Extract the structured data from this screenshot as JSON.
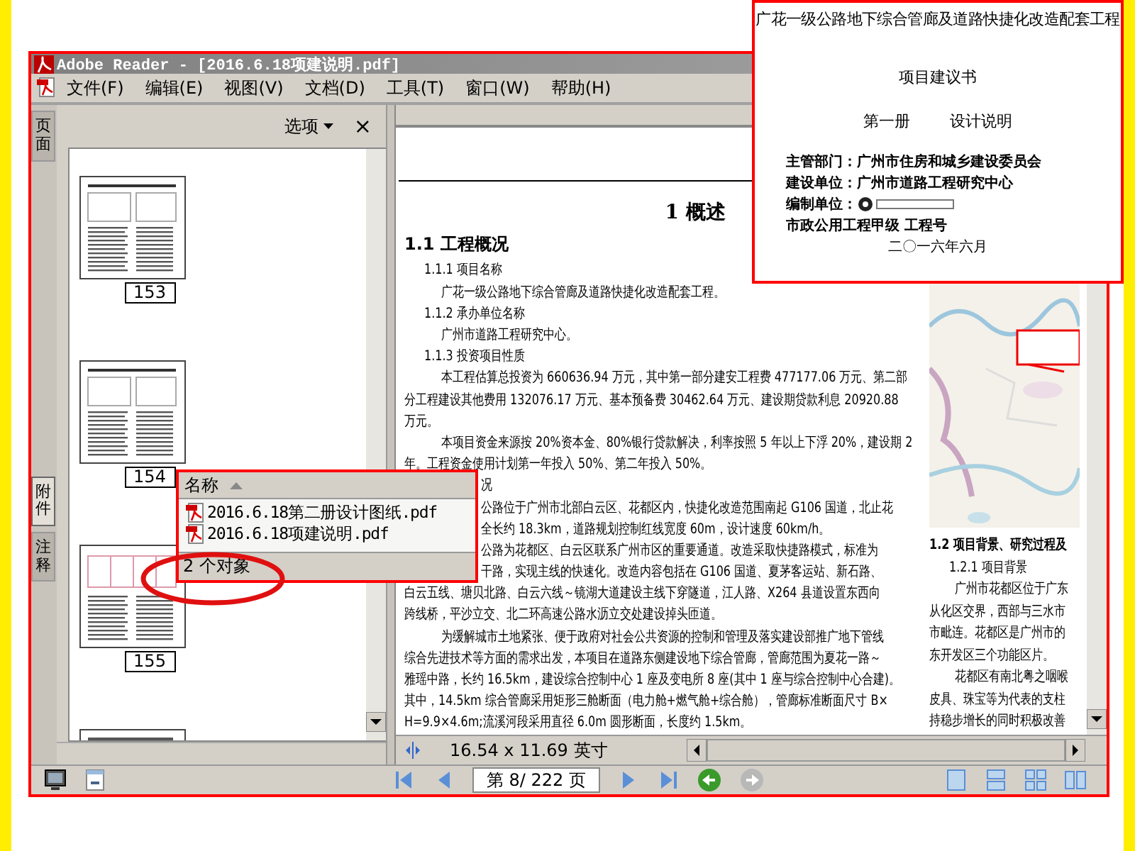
{
  "window": {
    "title": "Adobe Reader - [2016.6.18项建说明.pdf]"
  },
  "menu": [
    "文件(F)",
    "编辑(E)",
    "视图(V)",
    "文档(D)",
    "工具(T)",
    "窗口(W)",
    "帮助(H)"
  ],
  "side_tabs": [
    {
      "label": "页面",
      "selected": false
    },
    {
      "label": "附件",
      "selected": true
    },
    {
      "label": "注释",
      "selected": false
    }
  ],
  "nav_panel": {
    "options": "选项",
    "close": "×",
    "thumbnails": [
      "153",
      "154",
      "155"
    ]
  },
  "document": {
    "left_page": [
      {
        "kind": "title",
        "text": "1 概述"
      },
      {
        "kind": "h2",
        "text": "1.1 工程概况"
      },
      {
        "kind": "h3",
        "text": "1.1.1 项目名称"
      },
      {
        "kind": "indent",
        "text": "广花一级公路地下综合管廊及道路快捷化改造配套工程。"
      },
      {
        "kind": "h3",
        "text": "1.1.2 承办单位名称"
      },
      {
        "kind": "indent",
        "text": "广州市道路工程研究中心。"
      },
      {
        "kind": "h3",
        "text": "1.1.3 投资项目性质"
      },
      {
        "kind": "indent",
        "text": "本工程估算总投资为 660636.94 万元，其中第一部分建安工程费 477177.06 万元、第二部"
      },
      {
        "kind": "line",
        "text": "分工程建设其他费用 132076.17 万元、基本预备费 30462.64 万元、建设期贷款利息 20920.88"
      },
      {
        "kind": "line",
        "text": "万元。"
      },
      {
        "kind": "indent",
        "text": "本项目资金来源按 20%资本金、80%银行贷款解决，利率按照 5 年以上下浮 20%，建设期 2"
      },
      {
        "kind": "line",
        "text": "年。工程资金使用计划第一年投入 50%、第二年投入 50%。"
      },
      {
        "kind": "tail",
        "text": "况"
      },
      {
        "kind": "tail",
        "text": "公路位于广州市北部白云区、花都区内，快捷化改造范围南起 G106 国道，北止花"
      },
      {
        "kind": "tail",
        "text": "全长约 18.3km，道路规划控制红线宽度 60m，设计速度 60km/h。"
      },
      {
        "kind": "tail",
        "text": "公路为花都区、白云区联系广州市区的重要通道。改造采取快捷路模式，标准为"
      },
      {
        "kind": "tail",
        "text": "干路，实现主线的快速化。改造内容包括在 G106 国道、夏茅客运站、新石路、"
      },
      {
        "kind": "line",
        "text": "白云五线、塘贝北路、白云六线～镜湖大道建设主线下穿隧道，江人路、X264 县道设置东西向"
      },
      {
        "kind": "line",
        "text": "跨线桥，平沙立交、北二环高速公路水沥立交处建设掉头匝道。"
      },
      {
        "kind": "indent",
        "text": "为缓解城市土地紧张、便于政府对社会公共资源的控制和管理及落实建设部推广地下管线"
      },
      {
        "kind": "line",
        "text": "综合先进技术等方面的需求出发，本项目在道路东侧建设地下综合管廊，管廊范围为夏花一路～"
      },
      {
        "kind": "line",
        "text": "雅瑶中路，长约 16.5km，建设综合控制中心 1 座及变电所 8 座(其中 1 座与综合控制中心合建)。"
      },
      {
        "kind": "line",
        "text": "其中，14.5km 综合管廊采用矩形三舱断面（电力舱+燃气舱+综合舱），管廊标准断面尺寸 B×"
      },
      {
        "kind": "line",
        "text": "H=9.9×4.6m;流溪河段采用直径 6.0m 圆形断面，长度约 1.5km。"
      }
    ],
    "right_page": [
      {
        "kind": "h2",
        "text": "1.2 项目背景、研究过程及"
      },
      {
        "kind": "h3",
        "text": "1.2.1 项目背景"
      },
      {
        "kind": "indent",
        "text": "广州市花都区位于广东"
      },
      {
        "kind": "line",
        "text": "从化区交界，西部与三水市"
      },
      {
        "kind": "line",
        "text": "市毗连。花都区是广州市的"
      },
      {
        "kind": "line",
        "text": "东开发区三个功能区片。"
      },
      {
        "kind": "indent",
        "text": "花都区有南北粤之咽喉"
      },
      {
        "kind": "line",
        "text": "皮具、珠宝等为代表的支柱"
      },
      {
        "kind": "line",
        "text": "持稳步增长的同时积极改善"
      }
    ]
  },
  "doc_toolbar": {
    "page_size": "16.54 x 11.69 英寸"
  },
  "status_bar": {
    "page_field": "第 8/ 222 页",
    "previous_view": {
      "disabled": false
    },
    "next_view": {
      "disabled": true
    }
  },
  "attachments_popup": {
    "column": "名称",
    "files": [
      "2016.6.18第二册设计图纸.pdf",
      "2016.6.18项建说明.pdf"
    ],
    "count": "2 个对象"
  },
  "cover_page": {
    "title": "广花一级公路地下综合管廊及道路快捷化改造配套工程",
    "subtitle": "项目建议书",
    "volume": "第一册",
    "part": "设计说明",
    "details": [
      {
        "kind": "text",
        "text": "主管部门：广州市住房和城乡建设委员会"
      },
      {
        "kind": "text",
        "text": "建设单位：广州市道路工程研究中心"
      },
      {
        "kind": "logo",
        "text": "编制单位："
      },
      {
        "kind": "text",
        "text": "市政公用工程甲级 工程号"
      },
      {
        "kind": "date",
        "text": "二〇一六年六月"
      }
    ]
  }
}
